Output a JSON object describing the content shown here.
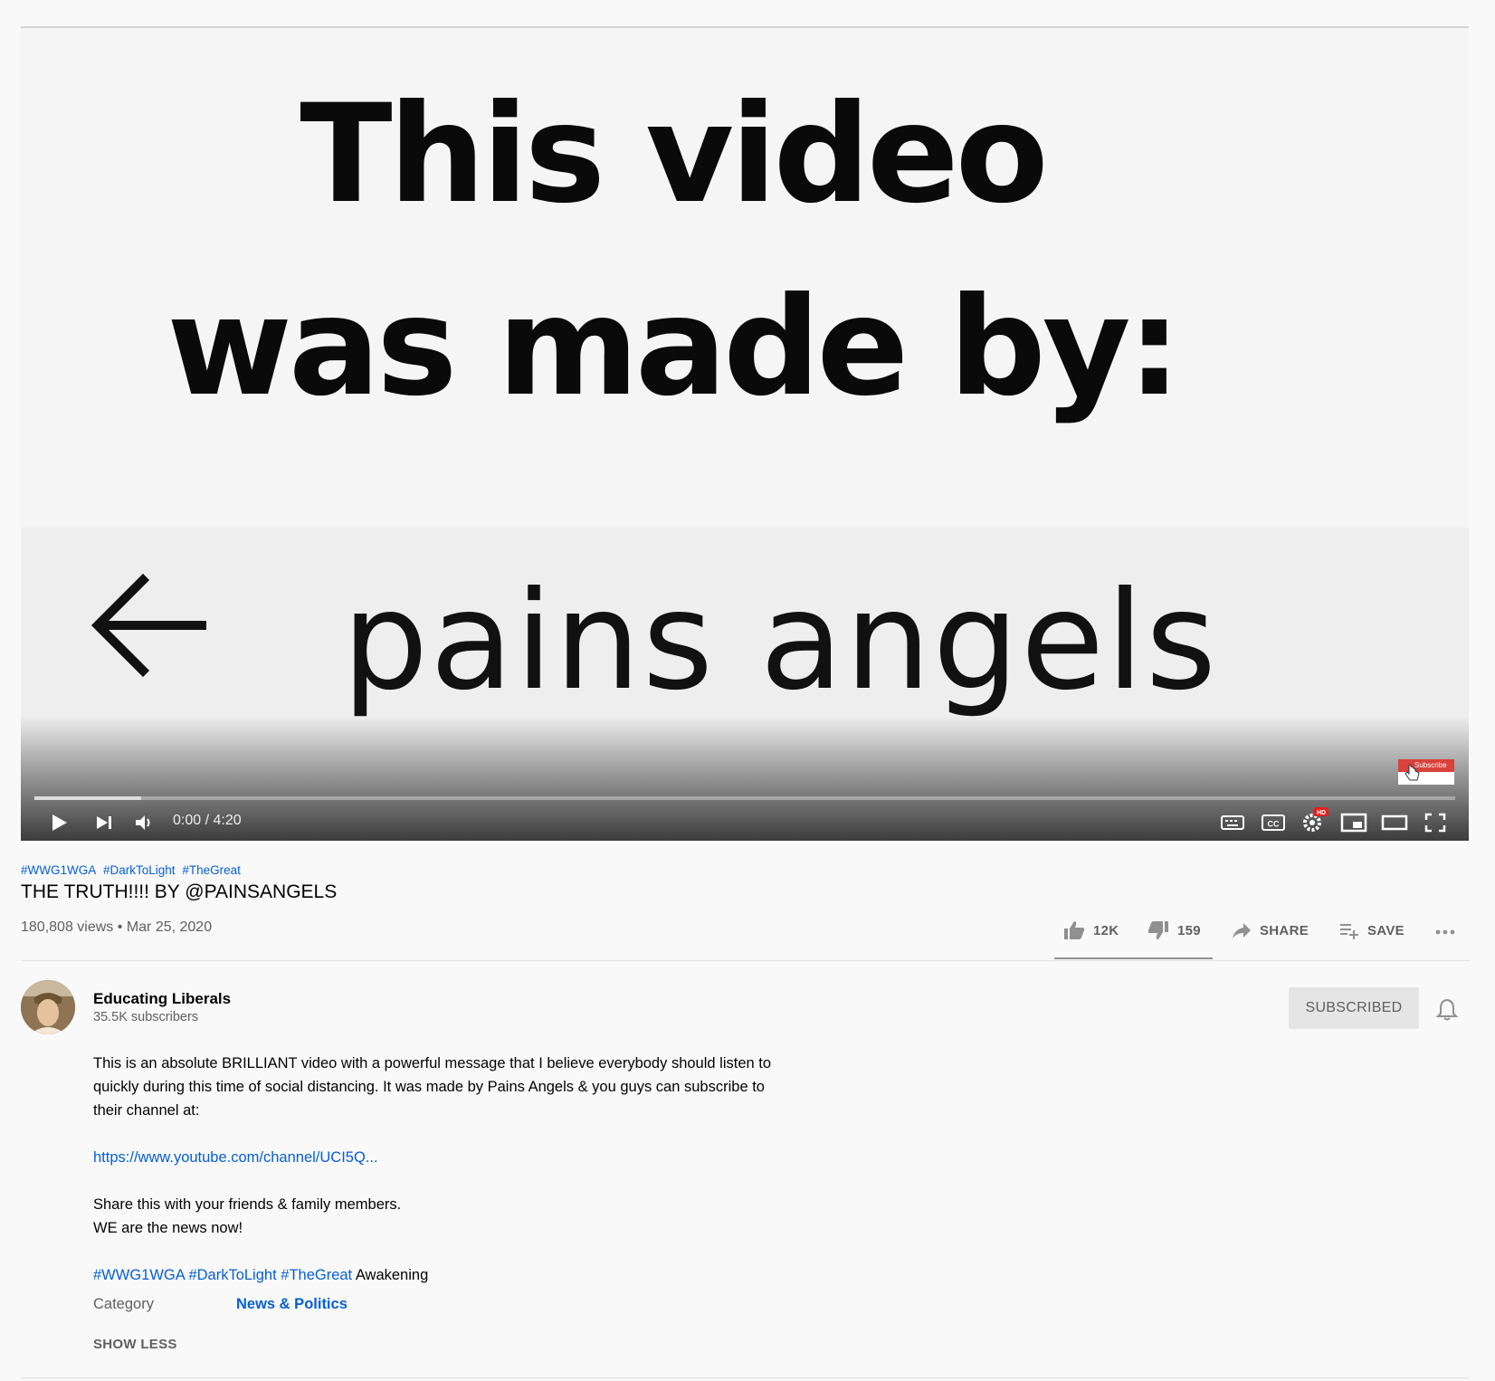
{
  "player": {
    "video_frame_text": {
      "line1": "This video",
      "line2": "was made by:",
      "line3": "pains angels"
    },
    "watermark_label": "Subscribe",
    "time_display": "0:00 / 4:20",
    "progress_loaded": 0.075,
    "icons": [
      "play-icon",
      "next-icon",
      "volume-icon",
      "keyboard-icon",
      "cc-icon",
      "settings-hd-icon",
      "miniplayer-icon",
      "theater-icon",
      "fullscreen-icon"
    ]
  },
  "video": {
    "hashtags": [
      "#WWG1WGA",
      "#DarkToLight",
      "#TheGreat"
    ],
    "title": "THE TRUTH!!!! BY @PAINSANGELS",
    "views": "180,808 views",
    "separator": "•",
    "date": "Mar 25, 2020"
  },
  "actions": {
    "likes": "12K",
    "dislikes": "159",
    "share": "SHARE",
    "save": "SAVE"
  },
  "channel": {
    "name": "Educating Liberals",
    "subscribers": "35.5K subscribers",
    "subscribe_button": "SUBSCRIBED"
  },
  "description": {
    "paragraph1": "This is an absolute BRILLIANT video with a powerful message that I believe everybody should listen to quickly during this time of social distancing. It was made by Pains Angels & you guys can subscribe to their channel at:",
    "link": "https://www.youtube.com/channel/UCI5Q...",
    "line_share": "Share this with your friends & family members.",
    "line_news": "WE are the news now!",
    "hashtags": [
      "#WWG1WGA",
      "#DarkToLight",
      "#TheGreat"
    ],
    "hashtag_suffix": "Awakening",
    "category_label": "Category",
    "category_value": "News & Politics",
    "show_less": "SHOW LESS"
  },
  "colors": {
    "link_blue": "#065fd4",
    "secondary_text": "#606060",
    "page_bg": "#f9f9f9"
  }
}
